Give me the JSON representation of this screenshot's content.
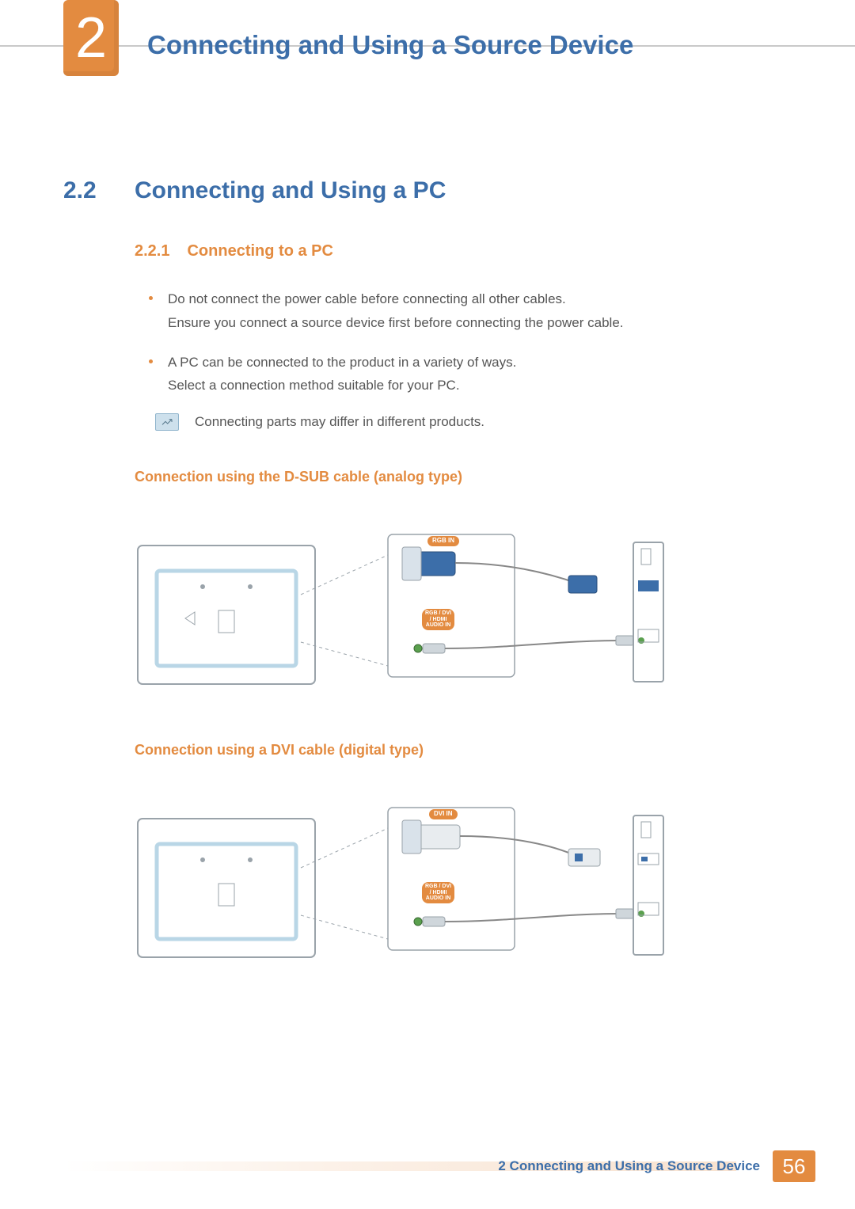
{
  "chapter": {
    "number": "2",
    "title": "Connecting and Using a Source Device"
  },
  "section": {
    "number": "2.2",
    "title": "Connecting and Using a PC"
  },
  "subsection": {
    "number": "2.2.1",
    "title": "Connecting to a PC"
  },
  "bullets": [
    {
      "line1": "Do not connect the power cable before connecting all other cables.",
      "line2": "Ensure you connect a source device first before connecting the power cable."
    },
    {
      "line1": "A PC can be connected to the product in a variety of ways.",
      "line2": "Select a connection method suitable for your PC."
    }
  ],
  "note": "Connecting parts may differ in different products.",
  "diagrams": {
    "dsub": {
      "heading": "Connection using the D-SUB cable (analog type)",
      "port_top": "RGB IN",
      "port_mid": "RGB / DVI\n/ HDMI\nAUDIO IN"
    },
    "dvi": {
      "heading": "Connection using a DVI cable (digital type)",
      "port_top": "DVI IN",
      "port_mid": "RGB / DVI\n/ HDMI\nAUDIO IN"
    }
  },
  "footer": {
    "text": "2 Connecting and Using a Source Device",
    "page": "56"
  }
}
